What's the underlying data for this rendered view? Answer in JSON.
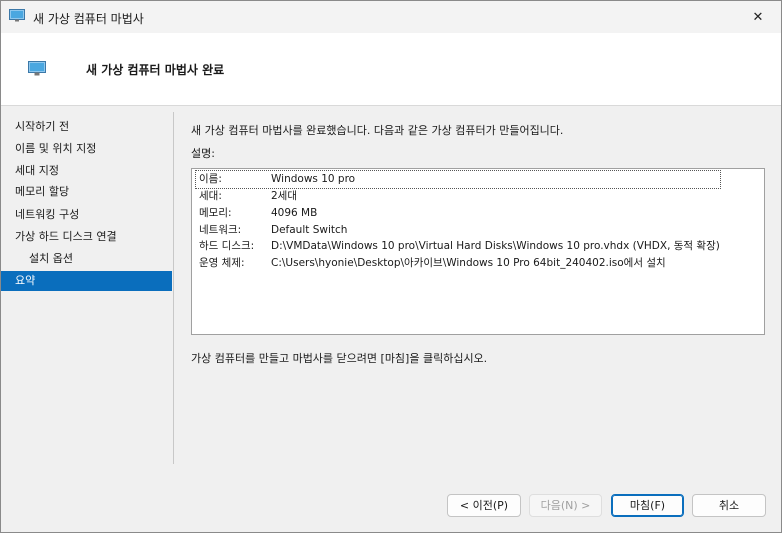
{
  "window": {
    "title": "새 가상 컴퓨터 마법사",
    "close_glyph": "✕"
  },
  "header": {
    "title": "새 가상 컴퓨터 마법사 완료"
  },
  "nav": {
    "items": [
      {
        "label": "시작하기 전"
      },
      {
        "label": "이름 및 위치 지정"
      },
      {
        "label": "세대 지정"
      },
      {
        "label": "메모리 할당"
      },
      {
        "label": "네트워킹 구성"
      },
      {
        "label": "가상 하드 디스크 연결"
      },
      {
        "label": "설치 옵션"
      },
      {
        "label": "요약"
      }
    ],
    "selected": "요약"
  },
  "main": {
    "intro": "새 가상 컴퓨터 마법사를 완료했습니다. 다음과 같은 가상 컴퓨터가 만들어집니다.",
    "description_label": "설명:",
    "summary": [
      {
        "key": "이름:",
        "value": "Windows 10 pro"
      },
      {
        "key": "세대:",
        "value": "2세대"
      },
      {
        "key": "메모리:",
        "value": "4096 MB"
      },
      {
        "key": "네트워크:",
        "value": "Default Switch"
      },
      {
        "key": "하드 디스크:",
        "value": "D:\\VMData\\Windows 10 pro\\Virtual Hard Disks\\Windows 10 pro.vhdx (VHDX, 동적 확장)"
      },
      {
        "key": "운영 체제:",
        "value": "C:\\Users\\hyonie\\Desktop\\아카이브\\Windows 10 Pro 64bit_240402.iso에서 설치"
      }
    ],
    "finish_note": "가상 컴퓨터를 만들고 마법사를 닫으려면 [마침]을 클릭하십시오."
  },
  "buttons": {
    "previous": "< 이전(P)",
    "next": "다음(N) >",
    "finish": "마침(F)",
    "cancel": "취소"
  },
  "colors": {
    "accent": "#0a6ebd"
  }
}
